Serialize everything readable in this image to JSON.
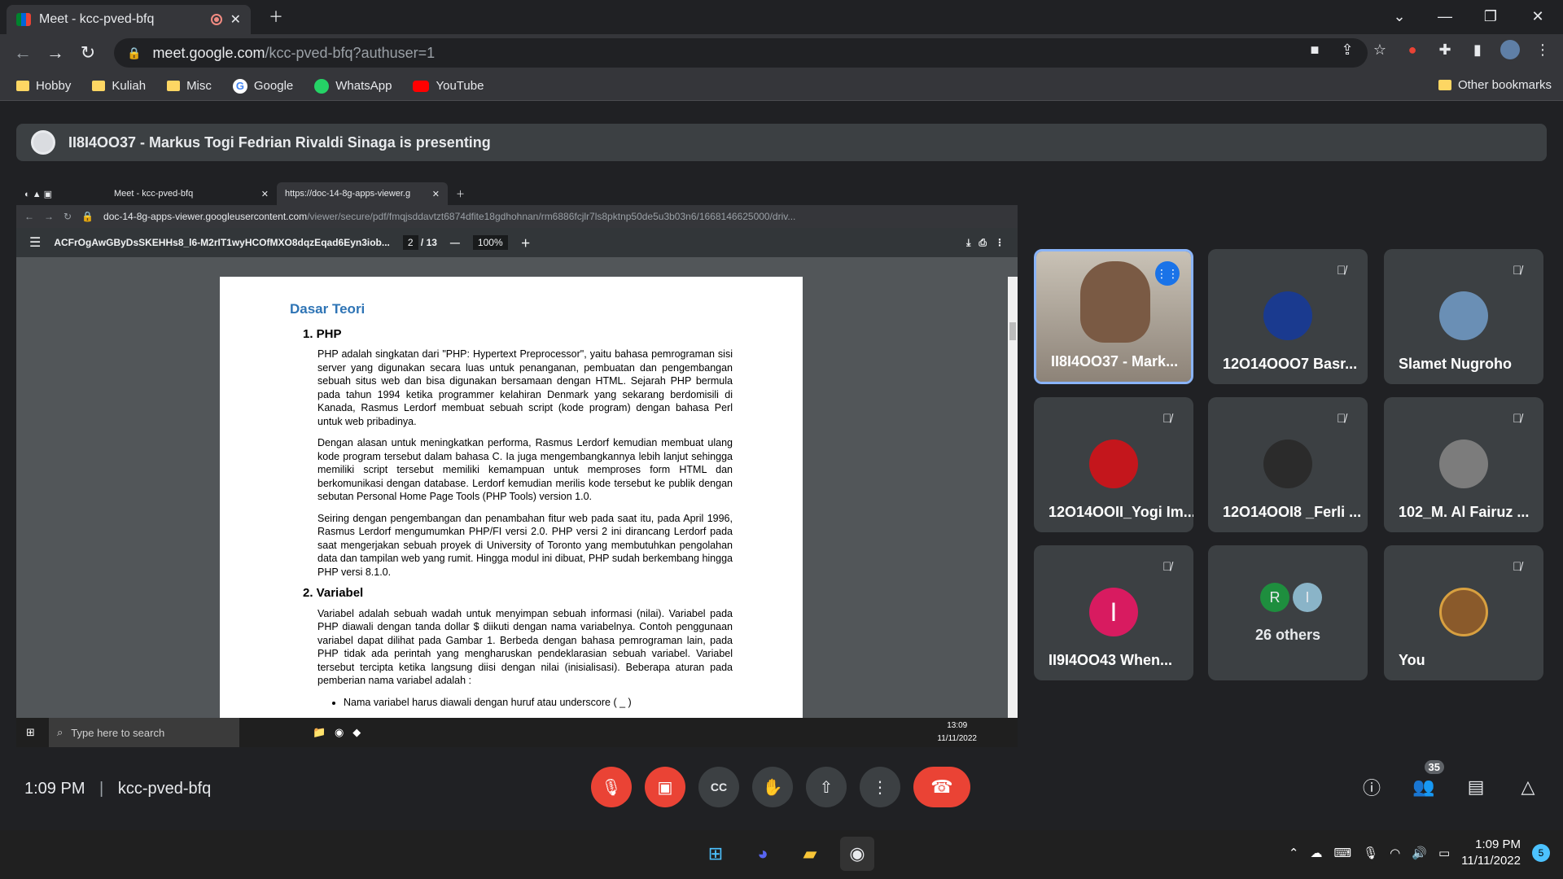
{
  "browser": {
    "tab_title": "Meet - kcc-pved-bfq",
    "url_host": "meet.google.com",
    "url_path": "/kcc-pved-bfq?authuser=1",
    "bookmarks": [
      "Hobby",
      "Kuliah",
      "Misc",
      "Google",
      "WhatsApp",
      "YouTube"
    ],
    "other_bookmarks": "Other bookmarks"
  },
  "presenting_banner": "II8I4OO37 - Markus Togi Fedrian Rivaldi Sinaga is presenting",
  "shared_screen": {
    "tab1": "Meet - kcc-pved-bfq",
    "tab2": "https://doc-14-8g-apps-viewer.g",
    "url_domain": "doc-14-8g-apps-viewer.googleusercontent.com",
    "url_path": "/viewer/secure/pdf/fmqjsddavtzt6874dfite18gdhohnan/rm6886fcjlr7ls8pktnp50de5u3b03n6/1668146625000/driv...",
    "pdf_title": "ACFrOgAwGByDsSKEHHs8_l6-M2rIT1wyHCOfMXO8dqzEqad6Eyn3iob...",
    "page": "2",
    "page_total": "/ 13",
    "zoom": "100%",
    "doc": {
      "heading": "Dasar Teori",
      "s1": "1.  PHP",
      "p1": "PHP adalah singkatan dari \"PHP: Hypertext Preprocessor\", yaitu bahasa pemrograman sisi server yang digunakan secara luas untuk penanganan, pembuatan dan pengembangan sebuah situs web dan bisa digunakan bersamaan dengan HTML. Sejarah PHP bermula pada tahun 1994 ketika programmer kelahiran Denmark yang sekarang berdomisili di Kanada, Rasmus Lerdorf membuat sebuah script (kode program) dengan bahasa Perl untuk web pribadinya.",
      "p2": "Dengan alasan untuk meningkatkan performa, Rasmus Lerdorf kemudian membuat ulang kode program tersebut dalam bahasa C. Ia juga mengembangkannya lebih lanjut sehingga memiliki script tersebut memiliki kemampuan untuk memproses form HTML dan berkomunikasi dengan database. Lerdorf kemudian merilis kode tersebut ke publik dengan sebutan Personal Home Page Tools (PHP Tools) version 1.0.",
      "p3": "Seiring dengan pengembangan dan penambahan fitur web pada saat itu, pada April 1996, Rasmus Lerdorf mengumumkan PHP/FI versi 2.0. PHP versi 2 ini dirancang Lerdorf pada saat mengerjakan sebuah proyek di University of Toronto yang membutuhkan pengolahan data dan tampilan web yang rumit. Hingga modul ini dibuat, PHP sudah berkembang hingga PHP versi 8.1.0.",
      "s2": "2.  Variabel",
      "p4": "Variabel adalah sebuah wadah untuk menyimpan sebuah informasi (nilai). Variabel pada PHP diawali dengan tanda dollar $ diikuti dengan nama variabelnya. Contoh penggunaan variabel dapat dilihat pada Gambar 1. Berbeda dengan bahasa pemrograman lain, pada PHP tidak ada perintah yang mengharuskan pendeklarasian sebuah variabel. Variabel tersebut tercipta ketika langsung diisi dengan nilai (inisialisasi). Beberapa aturan pada pemberian nama variabel adalah :",
      "bullet1": "Nama variabel harus diawali dengan huruf atau underscore ( _ )"
    },
    "taskbar_search": "Type here to search",
    "taskbar_time": "13:09",
    "taskbar_date": "11/11/2022"
  },
  "participants": [
    {
      "name": "II8I4OO37 - Mark...",
      "speaking": true
    },
    {
      "name": "12O14OOO7 Basr..."
    },
    {
      "name": "Slamet Nugroho"
    },
    {
      "name": "12O14OOII_Yogi Im..."
    },
    {
      "name": "12O14OOI8 _Ferli ..."
    },
    {
      "name": "102_M. Al Fairuz ..."
    },
    {
      "name": "II9I4OO43 When...",
      "initial": "I"
    },
    {
      "name": "26 others",
      "initials": [
        "R",
        "I"
      ]
    },
    {
      "name": "You"
    }
  ],
  "meeting": {
    "time": "1:09 PM",
    "code": "kcc-pved-bfq",
    "people_count": "35"
  },
  "windows_taskbar": {
    "time": "1:09 PM",
    "date": "11/11/2022",
    "notifications": "5"
  },
  "colors": {
    "accent": "#8ab4f8",
    "danger": "#ea4335"
  }
}
